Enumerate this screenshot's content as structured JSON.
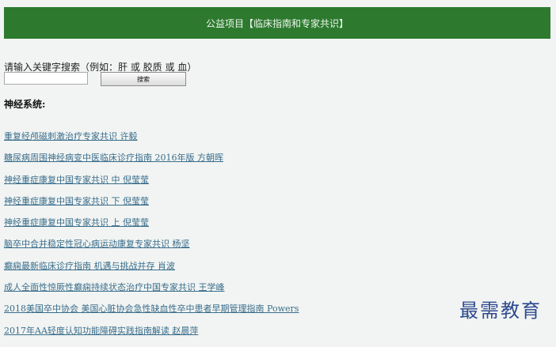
{
  "banner": {
    "title": "公益项目【临床指南和专家共识】"
  },
  "search": {
    "prompt": "请输入关键字搜索（例如：肝 或 胶质 或 血）",
    "input_value": "",
    "button_label": "搜索"
  },
  "section": {
    "heading": "神经系统:"
  },
  "links": [
    "重复经颅磁刺激治疗专家共识 许毅",
    "糖尿病周围神经病变中医临床诊疗指南 2016年版 方朝晖",
    "神经重症康复中国专家共识 中 倪莹莹",
    "神经重症康复中国专家共识 下 倪莹莹",
    "神经重症康复中国专家共识 上 倪莹莹",
    "脑卒中合并稳定性冠心病运动康复专家共识 杨坚",
    "癫痫最新临床诊疗指南 机遇与挑战并存 肖波",
    "成人全面性惊厥性癫痫持续状态治疗中国专家共识 王学峰",
    "2018美国卒中协会 美国心脏协会急性缺血性卒中患者早期管理指南 Powers",
    "2017年AA轻度认知功能障碍实践指南解读 赵晨萍"
  ],
  "watermark": {
    "text": "最需教育"
  }
}
